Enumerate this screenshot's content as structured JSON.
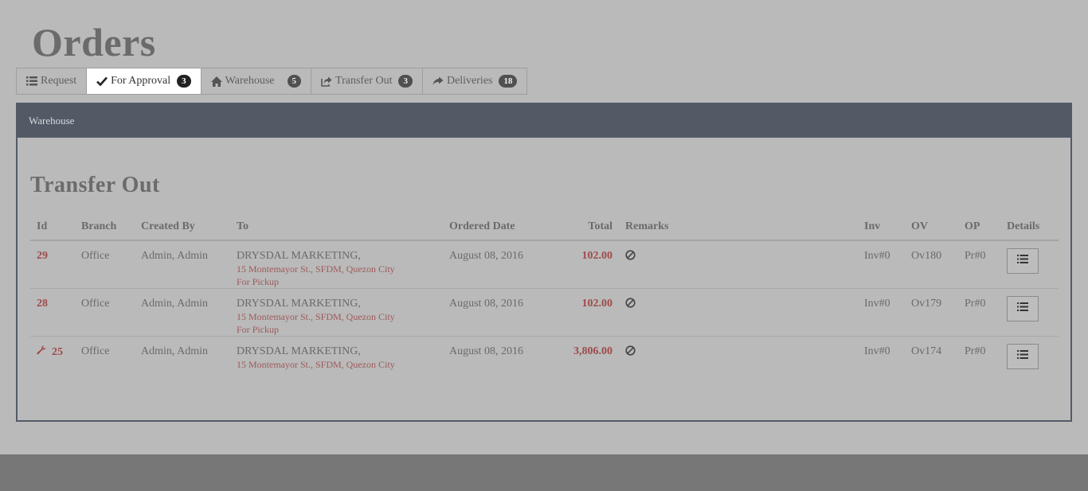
{
  "page": {
    "title": "Orders"
  },
  "tabs": [
    {
      "label": "Request",
      "icon": "list-icon",
      "badge": null,
      "active": false
    },
    {
      "label": "For  Approval",
      "icon": "check-icon",
      "badge": "3",
      "active": true
    },
    {
      "label": "Warehouse",
      "icon": "home-icon",
      "badge": "5",
      "active": false
    },
    {
      "label": "Transfer  Out",
      "icon": "share-icon",
      "badge": "3",
      "active": false
    },
    {
      "label": "Deliveries",
      "icon": "forward-arrow-icon",
      "badge": "18",
      "active": false
    }
  ],
  "panel": {
    "heading": "Warehouse",
    "section_title": "Transfer  Out"
  },
  "table": {
    "columns": [
      "Id",
      "Branch",
      "Created  By",
      "To",
      "Ordered  Date",
      "Total",
      "Remarks",
      "Inv",
      "OV",
      "OP",
      "Details"
    ],
    "rows": [
      {
        "id": "29",
        "branch": "Office",
        "created_by": "Admin,  Admin",
        "to_name": "DRYSDAL  MARKETING,",
        "to_address": "15  Montemayor   St.,  SFDM,  Quezon   City",
        "to_note": "For  Pickup",
        "date": "August  08,  2016",
        "total": "102.00",
        "remarks_icon": "ban-icon",
        "inv": "Inv#0",
        "ov": "Ov180",
        "op": "Pr#0",
        "has_wrench": false
      },
      {
        "id": "28",
        "branch": "Office",
        "created_by": "Admin,  Admin",
        "to_name": "DRYSDAL  MARKETING,",
        "to_address": "15  Montemayor   St.,  SFDM,  Quezon   City",
        "to_note": "For  Pickup",
        "date": "August  08,  2016",
        "total": "102.00",
        "remarks_icon": "ban-icon",
        "inv": "Inv#0",
        "ov": "Ov179",
        "op": "Pr#0",
        "has_wrench": false
      },
      {
        "id": "25",
        "branch": "Office",
        "created_by": "Admin,  Admin",
        "to_name": "DRYSDAL  MARKETING,",
        "to_address": "15  Montemayor   St.,  SFDM,  Quezon   City",
        "to_note": "",
        "date": "August  08,  2016",
        "total": "3,806.00",
        "remarks_icon": "ban-icon",
        "inv": "Inv#0",
        "ov": "Ov174",
        "op": "Pr#0",
        "has_wrench": true
      }
    ]
  }
}
